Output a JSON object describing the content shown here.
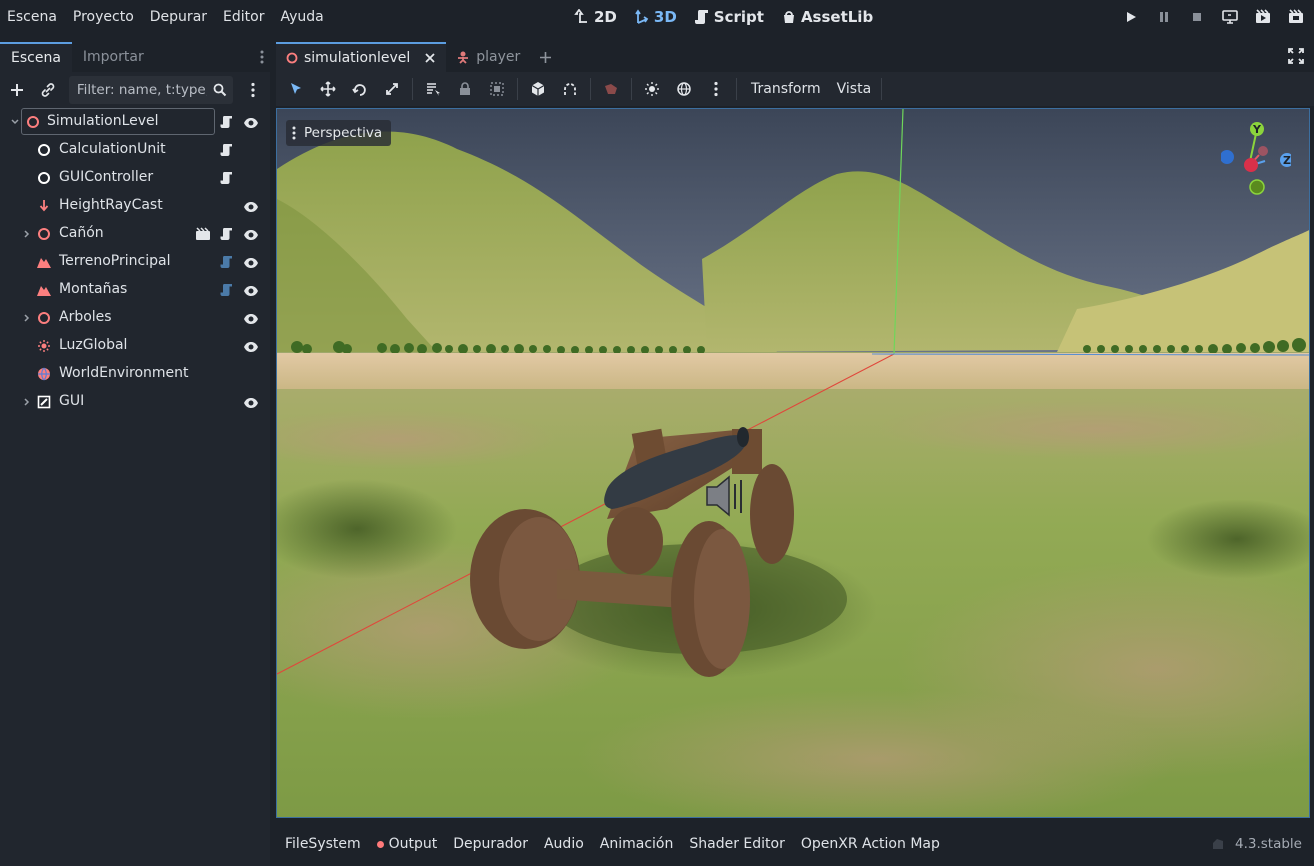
{
  "menu": [
    "Escena",
    "Proyecto",
    "Depurar",
    "Editor",
    "Ayuda"
  ],
  "workspaces": [
    {
      "label": "2D",
      "icon": "2d-icon",
      "active": false
    },
    {
      "label": "3D",
      "icon": "3d-icon",
      "active": true
    },
    {
      "label": "Script",
      "icon": "script-icon",
      "active": false
    },
    {
      "label": "AssetLib",
      "icon": "assetlib-icon",
      "active": false
    }
  ],
  "run_buttons": [
    "play-icon",
    "pause-icon",
    "stop-icon",
    "remote-debug-icon",
    "play-scene-icon",
    "play-custom-scene-icon"
  ],
  "scene_dock": {
    "tabs": [
      "Escena",
      "Importar"
    ],
    "filter_placeholder": "Filter: name, t:type, g:group"
  },
  "tree": [
    {
      "label": "SimulationLevel",
      "icon": "node3d-icon",
      "color": "#fc7f7f",
      "script": true,
      "visible": true,
      "expandable": true,
      "expanded": true,
      "level": 0
    },
    {
      "label": "CalculationUnit",
      "icon": "node-icon",
      "color": "#ffffff",
      "script": true,
      "visible": false,
      "expandable": false,
      "level": 1
    },
    {
      "label": "GUIController",
      "icon": "node-icon",
      "color": "#ffffff",
      "script": true,
      "visible": false,
      "expandable": false,
      "level": 1
    },
    {
      "label": "HeightRayCast",
      "icon": "raycast-icon",
      "color": "#fc7f7f",
      "script": false,
      "visible": true,
      "expandable": false,
      "level": 1
    },
    {
      "label": "Cañón",
      "icon": "node3d-icon",
      "color": "#fc7f7f",
      "script": true,
      "visible": true,
      "expandable": true,
      "instance": true,
      "level": 1
    },
    {
      "label": "TerrenoPrincipal",
      "icon": "mesh-icon",
      "color": "#fc7f7f",
      "script": true,
      "scriptTint": "#4b7aa8",
      "visible": true,
      "expandable": false,
      "level": 1
    },
    {
      "label": "Montañas",
      "icon": "mesh-icon",
      "color": "#fc7f7f",
      "script": true,
      "scriptTint": "#4b7aa8",
      "visible": true,
      "expandable": false,
      "level": 1
    },
    {
      "label": "Arboles",
      "icon": "node3d-icon",
      "color": "#fc7f7f",
      "script": false,
      "visible": true,
      "expandable": true,
      "level": 1
    },
    {
      "label": "LuzGlobal",
      "icon": "light-icon",
      "color": "#fc7f7f",
      "script": false,
      "visible": true,
      "expandable": false,
      "level": 1
    },
    {
      "label": "WorldEnvironment",
      "icon": "world-environment-icon",
      "color": "#fc7f7f",
      "script": false,
      "visible": false,
      "expandable": false,
      "level": 1
    },
    {
      "label": "GUI",
      "icon": "control-icon",
      "color": "#ffffff",
      "script": false,
      "visible": true,
      "expandable": true,
      "level": 1
    }
  ],
  "scene_tabs": [
    {
      "label": "simulationlevel",
      "icon": "node3d-icon",
      "active": true,
      "closable": true
    },
    {
      "label": "player",
      "icon": "characterbody-icon",
      "active": false
    }
  ],
  "viewport_toolbar": {
    "menus": [
      "Transform",
      "Vista"
    ]
  },
  "viewport": {
    "perspective_label": "Perspectiva",
    "gizmo": {
      "y": "Y",
      "z": "Z"
    }
  },
  "bottom_tabs": [
    {
      "label": "FileSystem",
      "dot": false
    },
    {
      "label": "Output",
      "dot": true
    },
    {
      "label": "Depurador",
      "dot": false
    },
    {
      "label": "Audio",
      "dot": false
    },
    {
      "label": "Animación",
      "dot": false
    },
    {
      "label": "Shader Editor",
      "dot": false
    },
    {
      "label": "OpenXR Action Map",
      "dot": false
    }
  ],
  "version": "4.3.stable",
  "colors": {
    "accent": "#5c9de0",
    "node3d": "#fc7f7f",
    "background": "#1d2229"
  }
}
